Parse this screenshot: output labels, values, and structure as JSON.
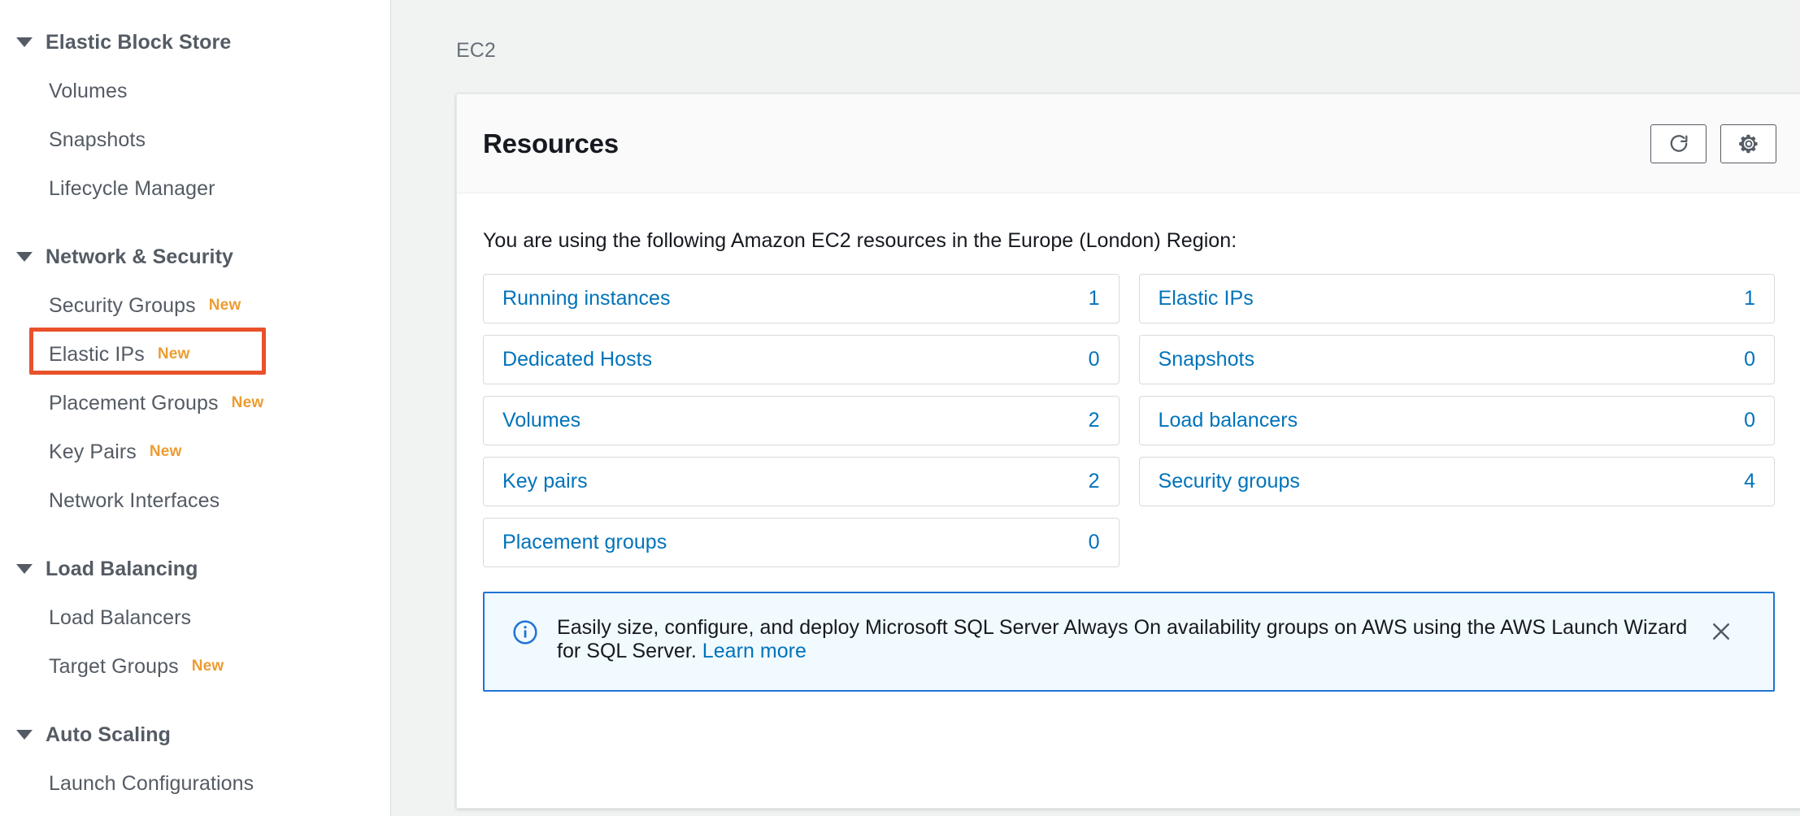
{
  "sidebar": {
    "groups": [
      {
        "title": "Elastic Block Store",
        "items": [
          {
            "label": "Volumes",
            "badge": ""
          },
          {
            "label": "Snapshots",
            "badge": ""
          },
          {
            "label": "Lifecycle Manager",
            "badge": ""
          }
        ]
      },
      {
        "title": "Network & Security",
        "items": [
          {
            "label": "Security Groups",
            "badge": "New"
          },
          {
            "label": "Elastic IPs",
            "badge": "New"
          },
          {
            "label": "Placement Groups",
            "badge": "New"
          },
          {
            "label": "Key Pairs",
            "badge": "New"
          },
          {
            "label": "Network Interfaces",
            "badge": ""
          }
        ]
      },
      {
        "title": "Load Balancing",
        "items": [
          {
            "label": "Load Balancers",
            "badge": ""
          },
          {
            "label": "Target Groups",
            "badge": "New"
          }
        ]
      },
      {
        "title": "Auto Scaling",
        "items": [
          {
            "label": "Launch Configurations",
            "badge": ""
          }
        ]
      }
    ],
    "highlighted_item": "Elastic IPs"
  },
  "breadcrumb": {
    "text": "EC2"
  },
  "panel": {
    "title": "Resources",
    "refresh_icon": "refresh-icon",
    "settings_icon": "gear-icon",
    "intro": "You are using the following Amazon EC2 resources in the Europe (London) Region:"
  },
  "resources": {
    "left_column": [
      {
        "label": "Running instances",
        "count": "1"
      },
      {
        "label": "Dedicated Hosts",
        "count": "0"
      },
      {
        "label": "Volumes",
        "count": "2"
      },
      {
        "label": "Key pairs",
        "count": "2"
      },
      {
        "label": "Placement groups",
        "count": "0"
      }
    ],
    "right_column": [
      {
        "label": "Elastic IPs",
        "count": "1"
      },
      {
        "label": "Snapshots",
        "count": "0"
      },
      {
        "label": "Load balancers",
        "count": "0"
      },
      {
        "label": "Security groups",
        "count": "4"
      }
    ]
  },
  "banner": {
    "icon": "info-icon",
    "text": "Easily size, configure, and deploy Microsoft SQL Server Always On availability groups on AWS using the AWS Launch Wizard for SQL Server. ",
    "link_label": "Learn more",
    "close_icon": "close-icon"
  },
  "colors": {
    "link_blue": "#0073bb",
    "badge_orange": "#eb9c32",
    "highlight_red": "#e8512a",
    "banner_border": "#2074d5",
    "banner_bg": "#f1faff",
    "text_gray": "#545b64",
    "page_bg": "#f1f3f3"
  }
}
